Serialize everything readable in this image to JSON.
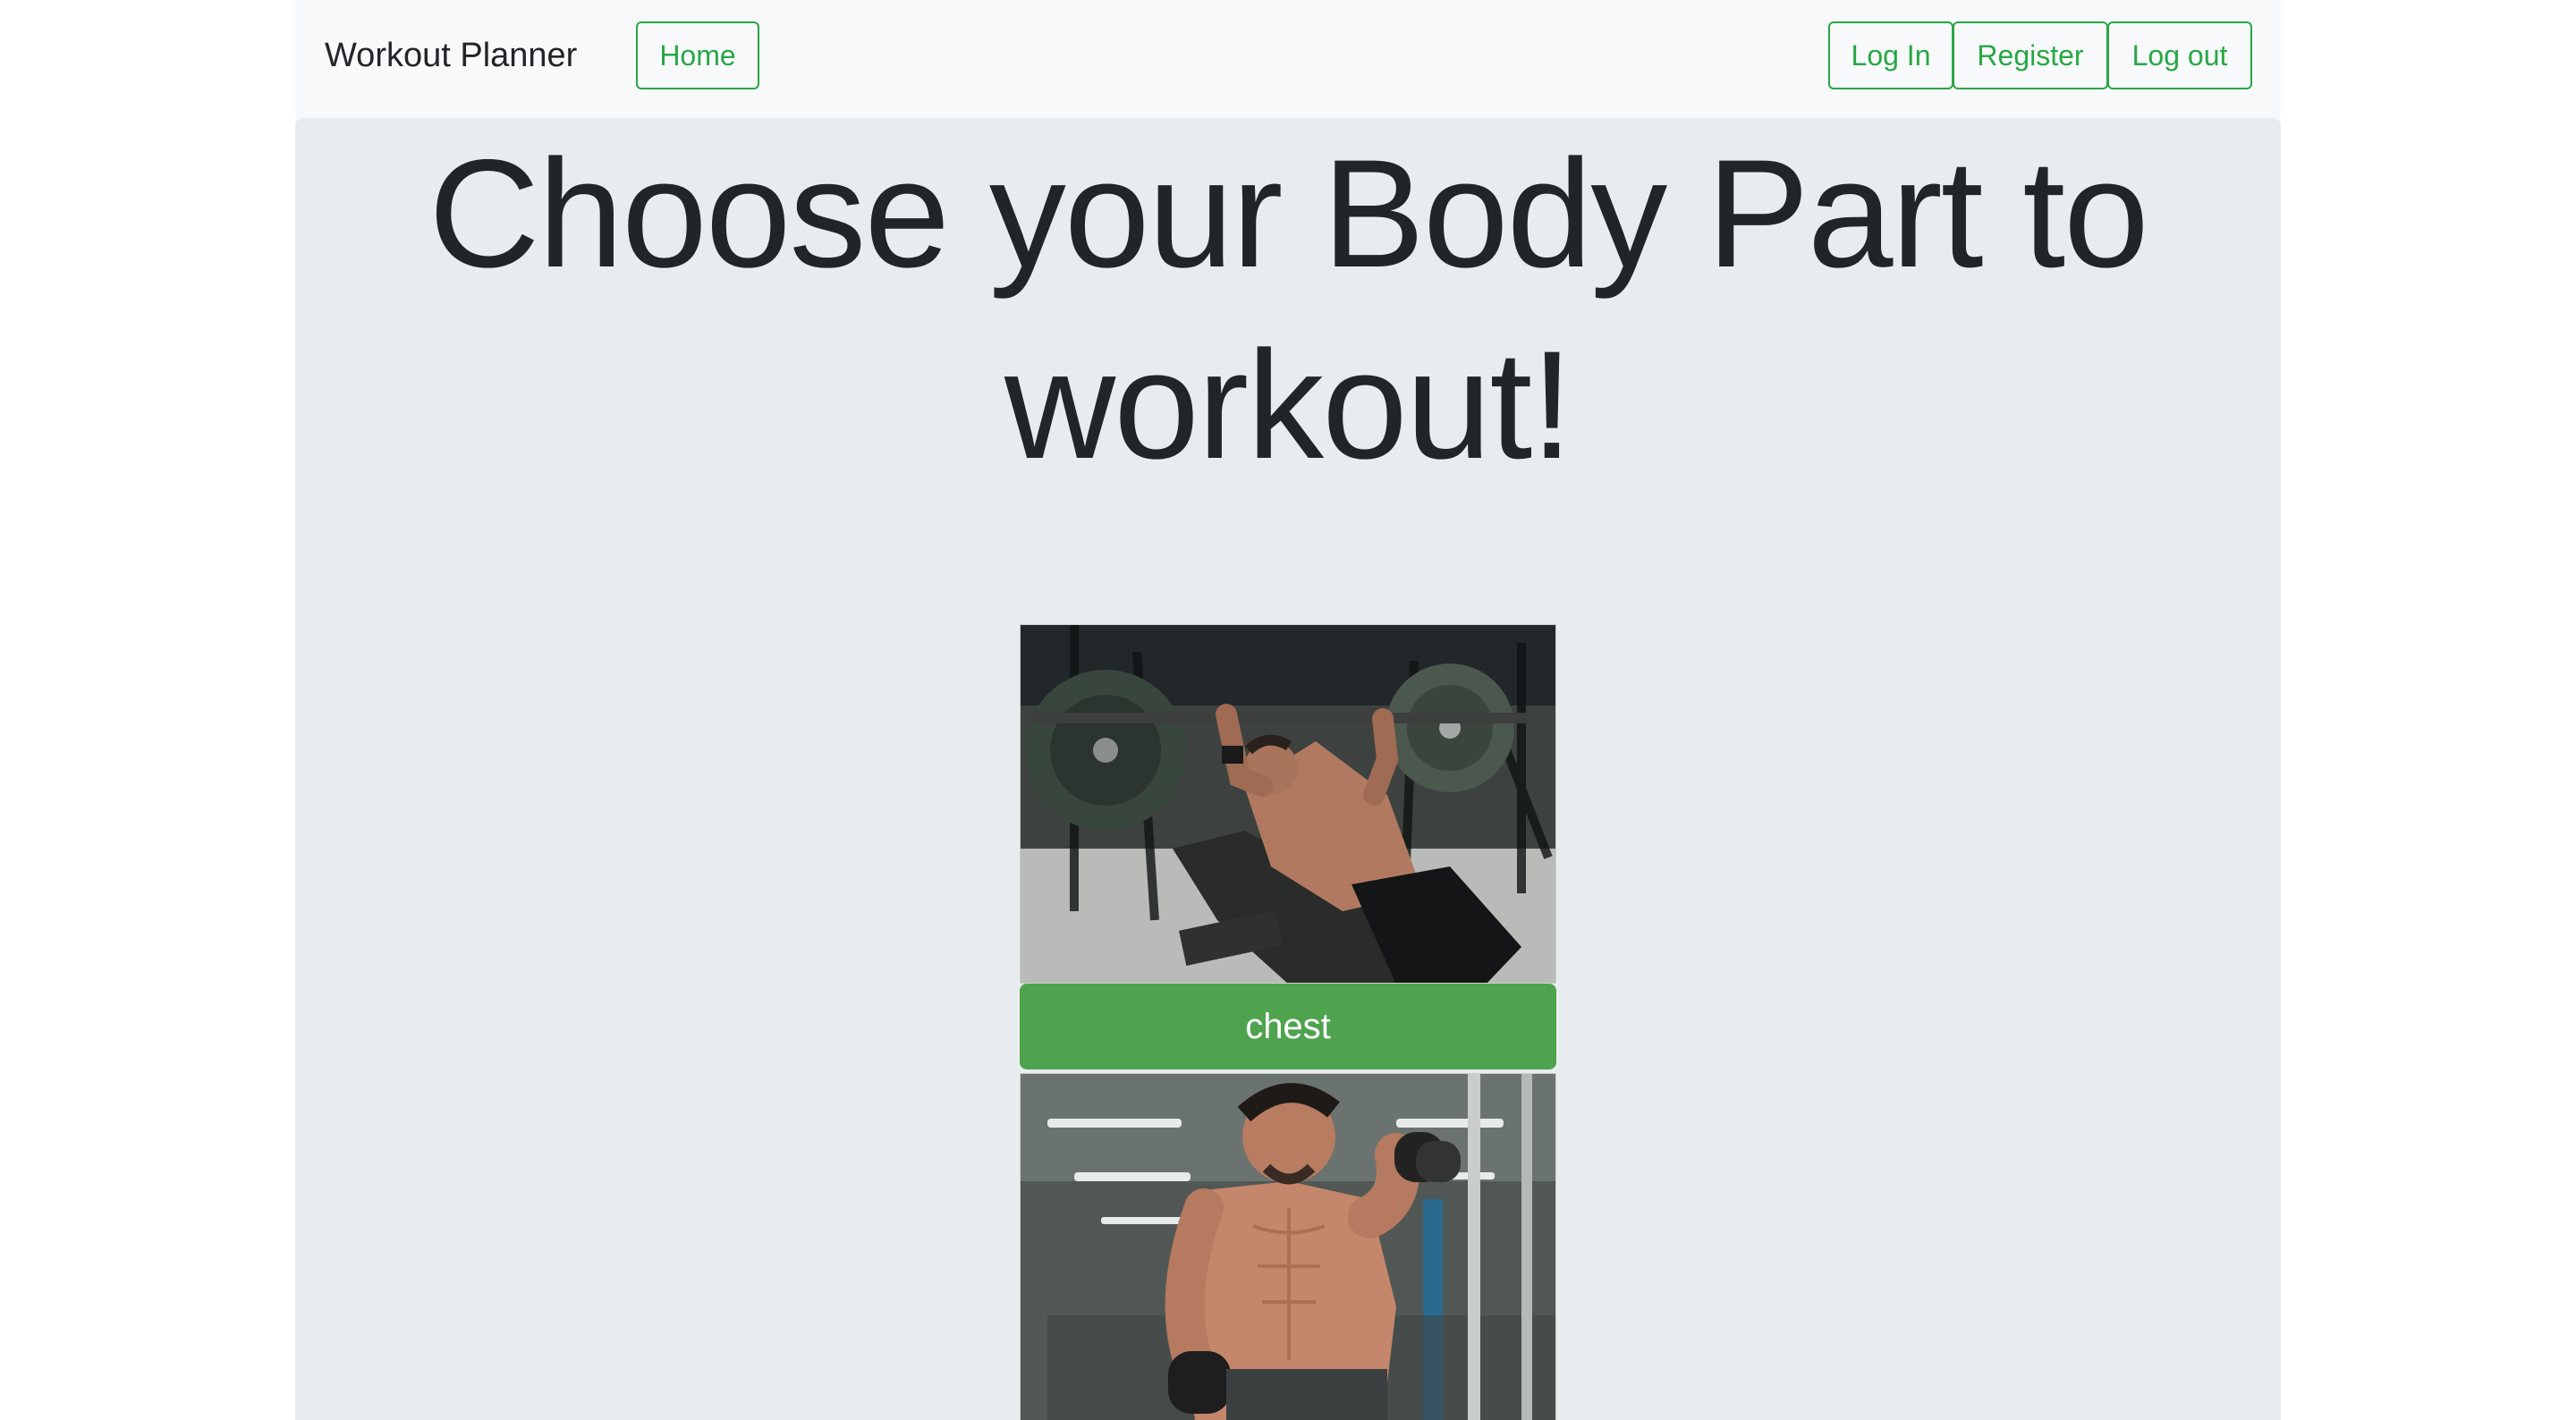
{
  "navbar": {
    "brand": "Workout Planner",
    "home_label": "Home",
    "login_label": "Log In",
    "register_label": "Register",
    "logout_label": "Log out"
  },
  "hero": {
    "heading": "Choose your Body Part to workout!"
  },
  "body_parts": [
    {
      "label": "chest",
      "image": "bench-press-photo"
    },
    {
      "label": "",
      "image": "dumbbell-curl-photo"
    }
  ],
  "colors": {
    "accent": "#28a745",
    "button_fill": "#4fa34f",
    "jumbotron_bg": "#e9ecef",
    "navbar_bg": "#f8f9fa"
  }
}
